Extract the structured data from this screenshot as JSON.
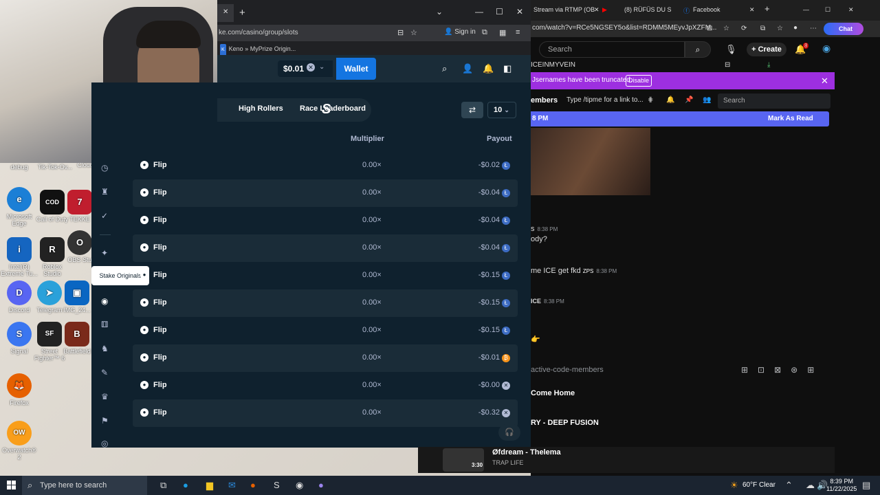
{
  "desktop": {
    "icons": [
      {
        "label": "debug",
        "color": "#555"
      },
      {
        "label": "Tik-Tok-Ov...",
        "color": "#444"
      },
      {
        "label": "Cloud",
        "color": "#777"
      },
      {
        "label": "Microsoft Edge",
        "color": "#1b7fd6",
        "glyph": "e"
      },
      {
        "label": "Call of Duty",
        "color": "#111",
        "glyph": "COD"
      },
      {
        "label": "TEKKE",
        "color": "#c01e2e",
        "glyph": "7"
      },
      {
        "label": "Intel(R) Extreme Tu...",
        "color": "#1565c0",
        "glyph": "i"
      },
      {
        "label": "Roblox Studio",
        "color": "#222",
        "glyph": "R"
      },
      {
        "label": "OBS Stu",
        "color": "#333",
        "glyph": "O"
      },
      {
        "label": "Discord",
        "color": "#5865f2",
        "glyph": "D"
      },
      {
        "label": "Telegram",
        "color": "#2aa1da",
        "glyph": "T"
      },
      {
        "label": "IMG_24...",
        "color": "#0a66c2",
        "glyph": "P"
      },
      {
        "label": "Signal",
        "color": "#3a76f0",
        "glyph": "S"
      },
      {
        "label": "Street Fighter™ 6",
        "color": "#222",
        "glyph": "SF"
      },
      {
        "label": "Battlefield",
        "color": "#7a2a1a",
        "glyph": "B"
      },
      {
        "label": "Firefox",
        "color": "#e66000",
        "glyph": "F"
      },
      {
        "label": "Overwatch® 2",
        "color": "#f99e1a",
        "glyph": "OW"
      }
    ]
  },
  "left_browser": {
    "url": "ke.com/casino/group/slots",
    "bookmark": "Keno » MyPrize Origin...",
    "bookmark_badge": "K",
    "sign_in": "Sign in"
  },
  "stake": {
    "balance": "$0.01",
    "wallet_label": "Wallet",
    "tabs": [
      "High Rollers",
      "Race Leaderboard"
    ],
    "rows_count": "10",
    "columns": {
      "multiplier": "Multiplier",
      "payout": "Payout"
    },
    "tooltip": "Stake Originals",
    "bets": [
      {
        "game": "Flip",
        "multiplier": "0.00×",
        "payout": "-$0.02",
        "coin": "ltc"
      },
      {
        "game": "Flip",
        "multiplier": "0.00×",
        "payout": "-$0.04",
        "coin": "ltc"
      },
      {
        "game": "Flip",
        "multiplier": "0.00×",
        "payout": "-$0.04",
        "coin": "ltc"
      },
      {
        "game": "Flip",
        "multiplier": "0.00×",
        "payout": "-$0.04",
        "coin": "ltc"
      },
      {
        "game": "Flip",
        "multiplier": "0.00×",
        "payout": "-$0.15",
        "coin": "ltc"
      },
      {
        "game": "Flip",
        "multiplier": "0.00×",
        "payout": "-$0.15",
        "coin": "ltc"
      },
      {
        "game": "Flip",
        "multiplier": "0.00×",
        "payout": "-$0.15",
        "coin": "ltc"
      },
      {
        "game": "Flip",
        "multiplier": "0.00×",
        "payout": "-$0.01",
        "coin": "btc"
      },
      {
        "game": "Flip",
        "multiplier": "0.00×",
        "payout": "-$0.00",
        "coin": "x"
      },
      {
        "game": "Flip",
        "multiplier": "0.00×",
        "payout": "-$0.32",
        "coin": "x"
      }
    ]
  },
  "right_browser": {
    "tabs": [
      "Stream via RTMP (OB",
      "(8) RÜFÜS DU S",
      "Facebook"
    ],
    "url": "com/watch?v=RCe5NGSEY5o&list=RDMM5MEyvJpXZFM...",
    "chat_button": "Chat",
    "search_placeholder": "Search",
    "create_label": "Create",
    "notif_count": "8",
    "channel_header": "ICEINMYVEIN",
    "truncated_notice": "Jsernames have been truncated.",
    "disable_label": "Disable",
    "members_title": "embers",
    "tip_placeholder": "Type /tipme for a link to...",
    "chat_search": "Search",
    "new_msg_time": "8 PM",
    "mark_as_read": "Mark As Read",
    "messages": [
      {
        "text": "s",
        "time": "8:38 PM"
      },
      {
        "text": "ody?",
        "time": ""
      },
      {
        "text": "me ICE get fkd",
        "time": "8:38 PM",
        "badge": "ZPS"
      },
      {
        "text": "ICE",
        "time": "8:38 PM"
      }
    ],
    "channel": "active-code-members",
    "songs": [
      {
        "title": "Come Home"
      },
      {
        "title": "RY - DEEP FUSION"
      }
    ],
    "now_playing": {
      "title": "Øfdream - Thelema",
      "artist": "TRAP LIFE",
      "duration": "3:30"
    }
  },
  "taskbar": {
    "search_placeholder": "Type here to search",
    "weather": "60°F Clear",
    "time": "8:39 PM",
    "date": "11/22/2025"
  }
}
